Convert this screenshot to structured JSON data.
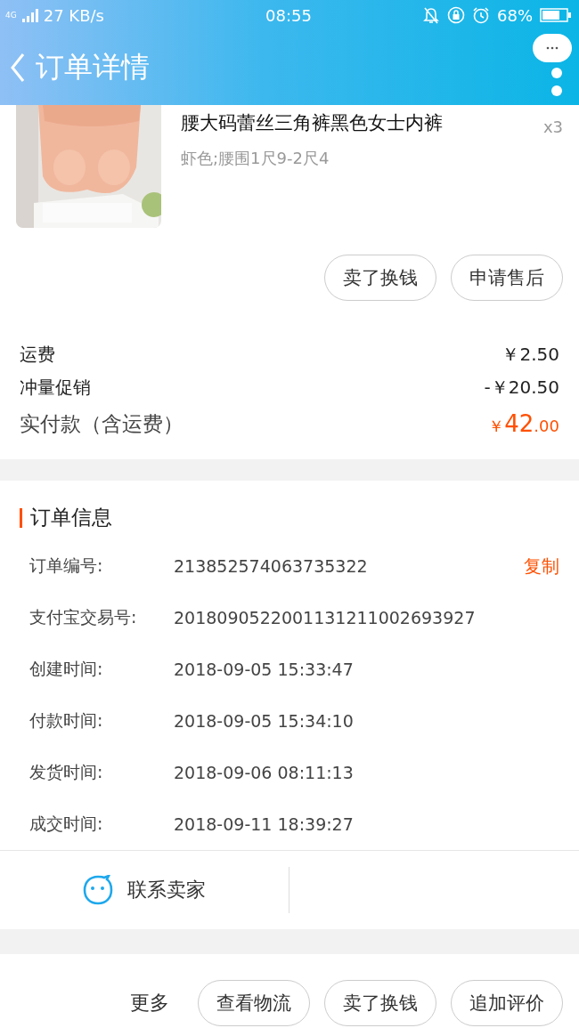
{
  "status_bar": {
    "network": "4G",
    "speed": "27 KB/s",
    "time": "08:55",
    "battery": "68%"
  },
  "header": {
    "title": "订单详情"
  },
  "product": {
    "title": "腰大码蕾丝三角裤黑色女士内裤",
    "sku": "虾色;腰围1尺9-2尺4",
    "quantity": "x3"
  },
  "item_actions": [
    "卖了换钱",
    "申请售后"
  ],
  "costs": [
    {
      "label": "运费",
      "value": "￥2.50"
    },
    {
      "label": "冲量促销",
      "value": "-￥20.50"
    }
  ],
  "total": {
    "label": "实付款（含运费）",
    "currency": "￥",
    "integer": "42",
    "decimal": ".00"
  },
  "order_info": {
    "title": "订单信息",
    "fields": [
      {
        "label": "订单编号:",
        "value": "213852574063735322",
        "action": "复制"
      },
      {
        "label": "支付宝交易号:",
        "value": "2018090522001131211002693927"
      },
      {
        "label": "创建时间:",
        "value": "2018-09-05 15:33:47"
      },
      {
        "label": "付款时间:",
        "value": "2018-09-05 15:34:10"
      },
      {
        "label": "发货时间:",
        "value": "2018-09-06 08:11:13"
      },
      {
        "label": "成交时间:",
        "value": "2018-09-11 18:39:27"
      }
    ]
  },
  "contact": {
    "label": "联系卖家"
  },
  "bottom_bar": {
    "more": "更多",
    "buttons": [
      "查看物流",
      "卖了换钱",
      "追加评价"
    ]
  }
}
